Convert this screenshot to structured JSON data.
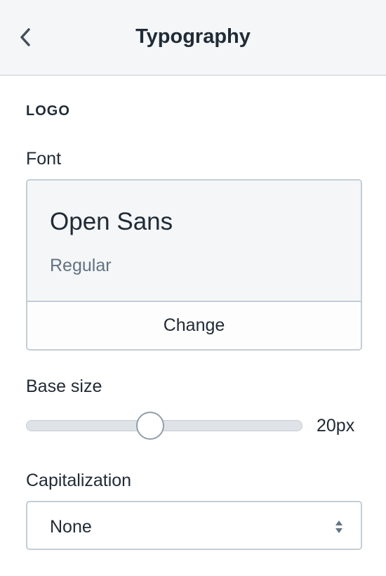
{
  "header": {
    "title": "Typography",
    "back_icon": "chevron-left-icon"
  },
  "section": {
    "heading": "LOGO"
  },
  "font": {
    "label": "Font",
    "name": "Open Sans",
    "style": "Regular",
    "change_label": "Change"
  },
  "base_size": {
    "label": "Base size",
    "value_text": "20px",
    "slider_fraction": 0.45
  },
  "capitalization": {
    "label": "Capitalization",
    "selected": "None",
    "arrow_icon": "select-arrows-icon"
  },
  "colors": {
    "header_bg": "#f4f6f8",
    "border": "#c4cdd5",
    "text": "#212b36",
    "muted_text": "#637381"
  }
}
